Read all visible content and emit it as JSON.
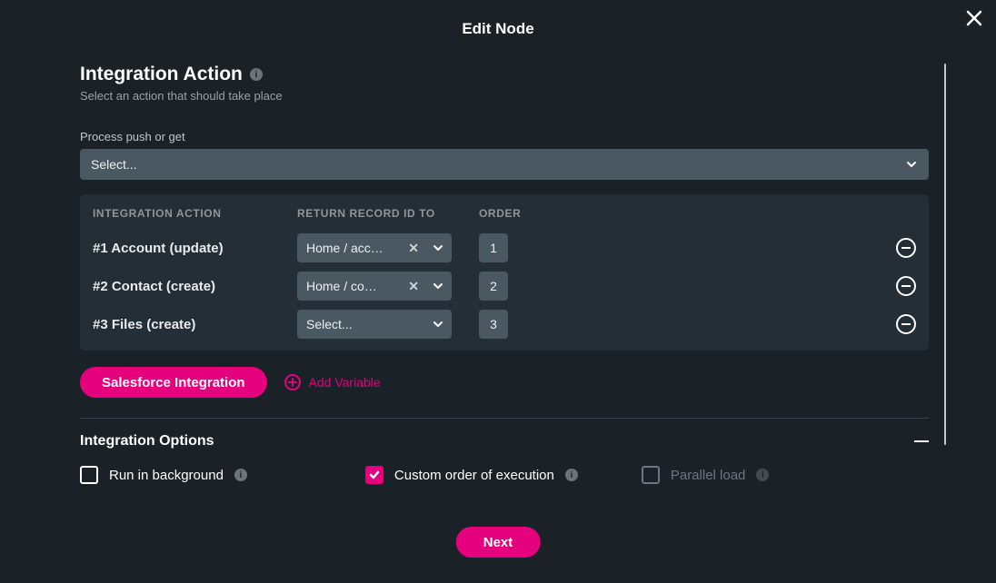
{
  "modal": {
    "title": "Edit Node"
  },
  "section": {
    "title": "Integration Action",
    "subtitle": "Select an action that should take place"
  },
  "processField": {
    "label": "Process push or get",
    "placeholder": "Select..."
  },
  "table": {
    "headers": {
      "action": "INTEGRATION ACTION",
      "return": "RETURN RECORD ID TO",
      "order": "ORDER"
    },
    "rows": [
      {
        "action": "#1 Account (update)",
        "return": "Home / acc…",
        "order": "1",
        "clearable": true
      },
      {
        "action": "#2 Contact (create)",
        "return": "Home / co…",
        "order": "2",
        "clearable": true
      },
      {
        "action": "#3 Files (create)",
        "return": "Select...",
        "order": "3",
        "clearable": false
      }
    ]
  },
  "buttons": {
    "salesforce": "Salesforce Integration",
    "addVariable": "Add Variable",
    "next": "Next"
  },
  "options": {
    "title": "Integration Options",
    "runInBackground": "Run in background",
    "customOrder": "Custom order of execution",
    "parallelLoad": "Parallel load"
  }
}
